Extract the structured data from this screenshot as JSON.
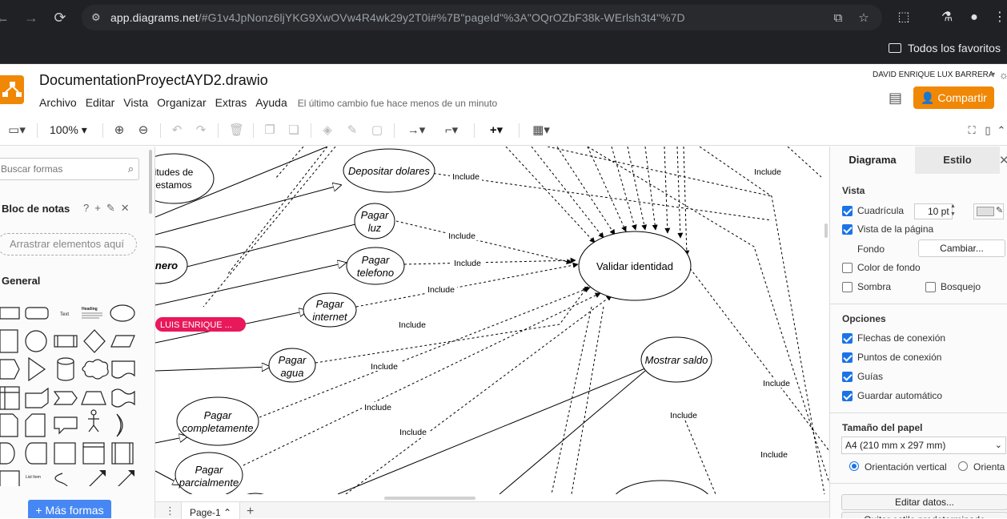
{
  "browser": {
    "url_host": "app.diagrams.net",
    "url_rest": "/#G1v4JpNonz6ljYKG9XwOVw4R4wk29y2T0i#%7B\"pageId\"%3A\"OQrOZbF38k-WErlsh3t4\"%7D",
    "bookmarks_folder": "Todos los favoritos"
  },
  "app": {
    "title": "DocumentationProyectAYD2.drawio",
    "menus": [
      "Archivo",
      "Editar",
      "Vista",
      "Organizar",
      "Extras",
      "Ayuda"
    ],
    "last_change": "El último cambio fue hace menos de un minuto",
    "user": "DAVID ENRIQUE LUX BARRERA",
    "share_label": "Compartir",
    "accent_color": "#f08705"
  },
  "toolbar": {
    "zoom": "100%"
  },
  "left_panel": {
    "search_placeholder": "Buscar formas",
    "notes_title": "Bloc de notas",
    "drop_hint": "Arrastrar elementos aquí",
    "general_title": "General",
    "shape_labels": {
      "text": "Text",
      "heading": "Heading",
      "list": "List Item"
    },
    "more_shapes": "+ Más formas"
  },
  "diagram": {
    "nodes": {
      "depositar": "Depositar dolares",
      "pagar_luz": [
        "Pagar",
        "luz"
      ],
      "pagar_telefono": [
        "Pagar",
        "telefono"
      ],
      "pagar_internet": [
        "Pagar",
        "internet"
      ],
      "pagar_agua": [
        "Pagar",
        "agua"
      ],
      "pagar_completamente": [
        "Pagar",
        "completamente"
      ],
      "pagar_parcialmente": [
        "Pagar",
        "parcialmente"
      ],
      "validar": "Validar identidad",
      "mostrar_saldo": "Mostrar saldo",
      "solicitudes": [
        "itudes de",
        "estamos"
      ],
      "dinero": "nero"
    },
    "edge_label": "Include",
    "cursor_tag": "LUIS ENRIQUE ..."
  },
  "pages": {
    "current": "Page-1"
  },
  "right_panel": {
    "tabs": [
      "Diagrama",
      "Estilo"
    ],
    "vista_title": "Vista",
    "grid_label": "Cuadrícula",
    "grid_size": "10 pt",
    "page_view_label": "Vista de la página",
    "fondo_label": "Fondo",
    "change_label": "Cambiar...",
    "bg_color_label": "Color de fondo",
    "shadow_label": "Sombra",
    "sketch_label": "Bosquejo",
    "options_title": "Opciones",
    "connection_arrows": "Flechas de conexión",
    "connection_points": "Puntos de conexión",
    "guides": "Guías",
    "autosave": "Guardar automático",
    "paper_title": "Tamaño del papel",
    "paper_size": "A4 (210 mm x 297 mm)",
    "portrait": "Orientación vertical",
    "landscape": "Orienta",
    "edit_data": "Editar datos...",
    "clear_style": "Quitar estilo predeterminado"
  }
}
